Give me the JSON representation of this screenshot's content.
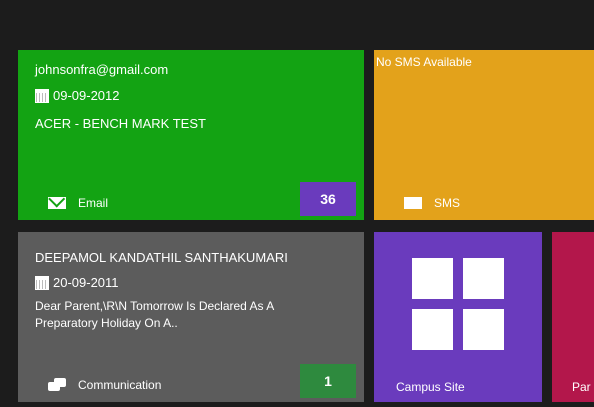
{
  "tiles": {
    "email": {
      "address": "johnsonfra@gmail.com",
      "date": "09-09-2012",
      "subject": "ACER - BENCH MARK TEST",
      "label": "Email",
      "count": "36"
    },
    "sms": {
      "status": "No SMS Available",
      "label": "SMS"
    },
    "communication": {
      "sender": "DEEPAMOL KANDATHIL SANTHAKUMARI",
      "date": "20-09-2011",
      "message": "Dear Parent,\\R\\N Tomorrow Is Declared As A Preparatory Holiday On A..",
      "label": "Communication",
      "count": "1"
    },
    "campus": {
      "label": "Campus Site"
    },
    "parent": {
      "label": "Par"
    }
  },
  "icons": {
    "email": "mail-icon",
    "sms": "sms-icon",
    "communication": "chat-icon",
    "calendar": "calendar-icon",
    "campus": "grid-icon"
  },
  "colors": {
    "email": "#13a313",
    "sms": "#e3a21b",
    "communication": "#5c5c5c",
    "campus": "#6a3bbd",
    "parent": "#b3174b",
    "background": "#1c1c1c"
  }
}
